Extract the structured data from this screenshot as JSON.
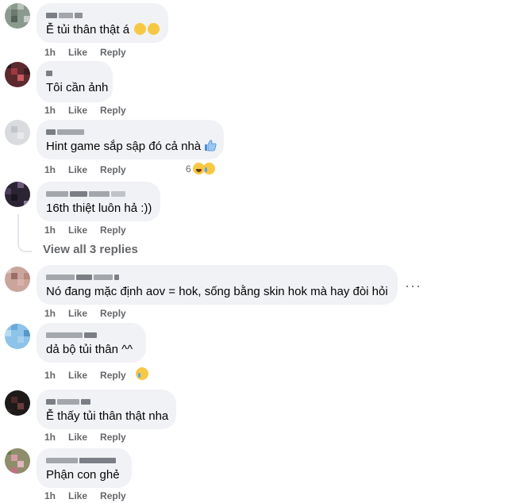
{
  "comments": [
    {
      "text": "Ễ tủi thân thật á",
      "time": "1h",
      "like": "Like",
      "reply": "Reply"
    },
    {
      "text": "Tôi cần ảnh",
      "time": "1h",
      "like": "Like",
      "reply": "Reply"
    },
    {
      "text": "Hint game sắp sập đó cả nhà",
      "time": "1h",
      "like": "Like",
      "reply": "Reply",
      "reaction_count": "6"
    },
    {
      "text": "16th thiệt luôn hả :))",
      "time": "1h",
      "like": "Like",
      "reply": "Reply"
    },
    {
      "text": "Nó đang mặc định aov = hok, sống bằng skin hok mà hay đòi hỏi",
      "time": "1h",
      "like": "Like",
      "reply": "Reply"
    },
    {
      "text": "dả bộ tủi thân ^^",
      "time": "1h",
      "like": "Like",
      "reply": "Reply"
    },
    {
      "text": "Ễ thấy tủi thân thật nha",
      "time": "1h",
      "like": "Like",
      "reply": "Reply"
    },
    {
      "text": "Phận con ghẻ",
      "time": "1h",
      "like": "Like",
      "reply": "Reply"
    }
  ],
  "view_all_replies": "View all 3 replies",
  "more_options": "···",
  "colors": {
    "bubble": "#f0f2f5",
    "meta": "#65676b"
  }
}
